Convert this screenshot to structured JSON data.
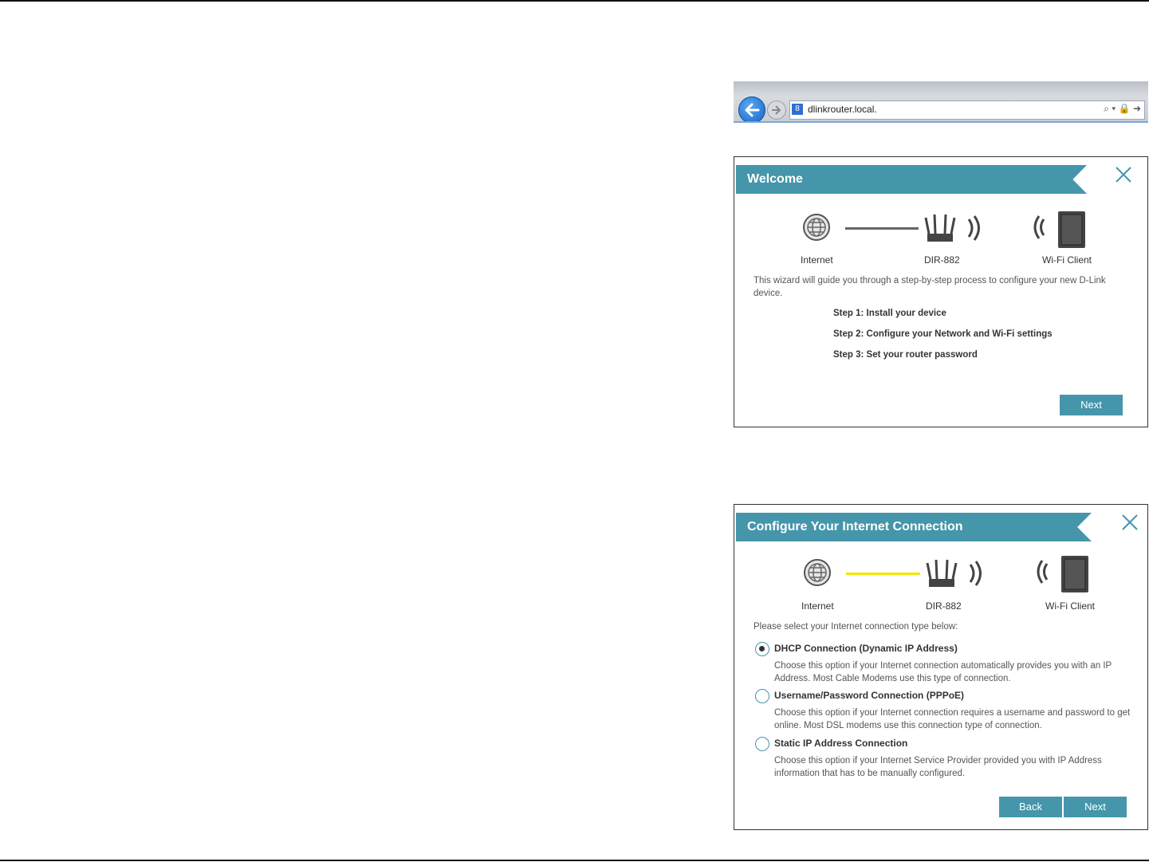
{
  "browser": {
    "url": "dlinkrouter.local.",
    "favicon_letter": "8",
    "addr_icons": "⌕ ▾ 🔒 ➜",
    "icons": [
      "back-arrow-icon",
      "forward-arrow-icon",
      "search-icon",
      "lock-icon",
      "refresh-icon"
    ]
  },
  "welcome": {
    "title": "Welcome",
    "diagram": {
      "internet": "Internet",
      "router": "DIR-882",
      "client": "Wi-Fi Client"
    },
    "intro": "This wizard will guide you through a step-by-step process to configure your new D-Link device.",
    "steps": [
      "Step 1: Install your device",
      "Step 2: Configure your Network and Wi-Fi settings",
      "Step 3: Set your router password"
    ],
    "next_label": "Next"
  },
  "config": {
    "title": "Configure Your Internet Connection",
    "diagram": {
      "internet": "Internet",
      "router": "DIR-882",
      "client": "Wi-Fi Client"
    },
    "prompt": "Please select your Internet connection type below:",
    "options": [
      {
        "label": "DHCP Connection (Dynamic IP Address)",
        "desc": "Choose this option if your Internet connection automatically provides you with an IP Address. Most Cable Modems use this type of connection.",
        "selected": true
      },
      {
        "label": "Username/Password Connection (PPPoE)",
        "desc": "Choose this option if your Internet connection requires a username and password to get online. Most DSL modems use this connection type of connection.",
        "selected": false
      },
      {
        "label": "Static IP Address Connection",
        "desc": "Choose this option if your Internet Service Provider provided you with IP Address information that has to be manually configured.",
        "selected": false
      }
    ],
    "back_label": "Back",
    "next_label": "Next"
  },
  "colors": {
    "accent": "#4596ab",
    "wire_active": "#f2e600",
    "wire_idle": "#666666"
  }
}
